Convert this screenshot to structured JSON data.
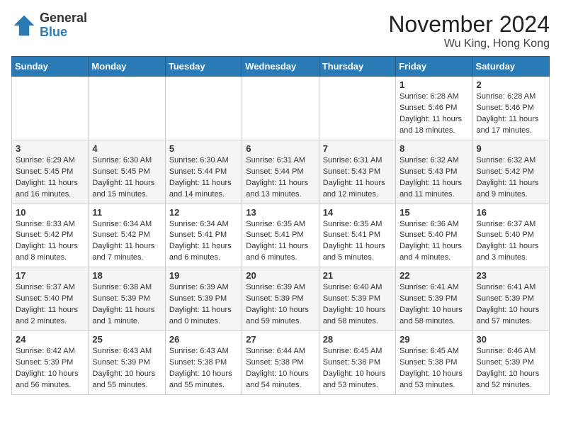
{
  "header": {
    "logo_general": "General",
    "logo_blue": "Blue",
    "month_title": "November 2024",
    "location": "Wu King, Hong Kong"
  },
  "days_of_week": [
    "Sunday",
    "Monday",
    "Tuesday",
    "Wednesday",
    "Thursday",
    "Friday",
    "Saturday"
  ],
  "weeks": [
    [
      {
        "day": "",
        "info": ""
      },
      {
        "day": "",
        "info": ""
      },
      {
        "day": "",
        "info": ""
      },
      {
        "day": "",
        "info": ""
      },
      {
        "day": "",
        "info": ""
      },
      {
        "day": "1",
        "info": "Sunrise: 6:28 AM\nSunset: 5:46 PM\nDaylight: 11 hours and 18 minutes."
      },
      {
        "day": "2",
        "info": "Sunrise: 6:28 AM\nSunset: 5:46 PM\nDaylight: 11 hours and 17 minutes."
      }
    ],
    [
      {
        "day": "3",
        "info": "Sunrise: 6:29 AM\nSunset: 5:45 PM\nDaylight: 11 hours and 16 minutes."
      },
      {
        "day": "4",
        "info": "Sunrise: 6:30 AM\nSunset: 5:45 PM\nDaylight: 11 hours and 15 minutes."
      },
      {
        "day": "5",
        "info": "Sunrise: 6:30 AM\nSunset: 5:44 PM\nDaylight: 11 hours and 14 minutes."
      },
      {
        "day": "6",
        "info": "Sunrise: 6:31 AM\nSunset: 5:44 PM\nDaylight: 11 hours and 13 minutes."
      },
      {
        "day": "7",
        "info": "Sunrise: 6:31 AM\nSunset: 5:43 PM\nDaylight: 11 hours and 12 minutes."
      },
      {
        "day": "8",
        "info": "Sunrise: 6:32 AM\nSunset: 5:43 PM\nDaylight: 11 hours and 11 minutes."
      },
      {
        "day": "9",
        "info": "Sunrise: 6:32 AM\nSunset: 5:42 PM\nDaylight: 11 hours and 9 minutes."
      }
    ],
    [
      {
        "day": "10",
        "info": "Sunrise: 6:33 AM\nSunset: 5:42 PM\nDaylight: 11 hours and 8 minutes."
      },
      {
        "day": "11",
        "info": "Sunrise: 6:34 AM\nSunset: 5:42 PM\nDaylight: 11 hours and 7 minutes."
      },
      {
        "day": "12",
        "info": "Sunrise: 6:34 AM\nSunset: 5:41 PM\nDaylight: 11 hours and 6 minutes."
      },
      {
        "day": "13",
        "info": "Sunrise: 6:35 AM\nSunset: 5:41 PM\nDaylight: 11 hours and 6 minutes."
      },
      {
        "day": "14",
        "info": "Sunrise: 6:35 AM\nSunset: 5:41 PM\nDaylight: 11 hours and 5 minutes."
      },
      {
        "day": "15",
        "info": "Sunrise: 6:36 AM\nSunset: 5:40 PM\nDaylight: 11 hours and 4 minutes."
      },
      {
        "day": "16",
        "info": "Sunrise: 6:37 AM\nSunset: 5:40 PM\nDaylight: 11 hours and 3 minutes."
      }
    ],
    [
      {
        "day": "17",
        "info": "Sunrise: 6:37 AM\nSunset: 5:40 PM\nDaylight: 11 hours and 2 minutes."
      },
      {
        "day": "18",
        "info": "Sunrise: 6:38 AM\nSunset: 5:39 PM\nDaylight: 11 hours and 1 minute."
      },
      {
        "day": "19",
        "info": "Sunrise: 6:39 AM\nSunset: 5:39 PM\nDaylight: 11 hours and 0 minutes."
      },
      {
        "day": "20",
        "info": "Sunrise: 6:39 AM\nSunset: 5:39 PM\nDaylight: 10 hours and 59 minutes."
      },
      {
        "day": "21",
        "info": "Sunrise: 6:40 AM\nSunset: 5:39 PM\nDaylight: 10 hours and 58 minutes."
      },
      {
        "day": "22",
        "info": "Sunrise: 6:41 AM\nSunset: 5:39 PM\nDaylight: 10 hours and 58 minutes."
      },
      {
        "day": "23",
        "info": "Sunrise: 6:41 AM\nSunset: 5:39 PM\nDaylight: 10 hours and 57 minutes."
      }
    ],
    [
      {
        "day": "24",
        "info": "Sunrise: 6:42 AM\nSunset: 5:39 PM\nDaylight: 10 hours and 56 minutes."
      },
      {
        "day": "25",
        "info": "Sunrise: 6:43 AM\nSunset: 5:39 PM\nDaylight: 10 hours and 55 minutes."
      },
      {
        "day": "26",
        "info": "Sunrise: 6:43 AM\nSunset: 5:38 PM\nDaylight: 10 hours and 55 minutes."
      },
      {
        "day": "27",
        "info": "Sunrise: 6:44 AM\nSunset: 5:38 PM\nDaylight: 10 hours and 54 minutes."
      },
      {
        "day": "28",
        "info": "Sunrise: 6:45 AM\nSunset: 5:38 PM\nDaylight: 10 hours and 53 minutes."
      },
      {
        "day": "29",
        "info": "Sunrise: 6:45 AM\nSunset: 5:38 PM\nDaylight: 10 hours and 53 minutes."
      },
      {
        "day": "30",
        "info": "Sunrise: 6:46 AM\nSunset: 5:39 PM\nDaylight: 10 hours and 52 minutes."
      }
    ]
  ]
}
